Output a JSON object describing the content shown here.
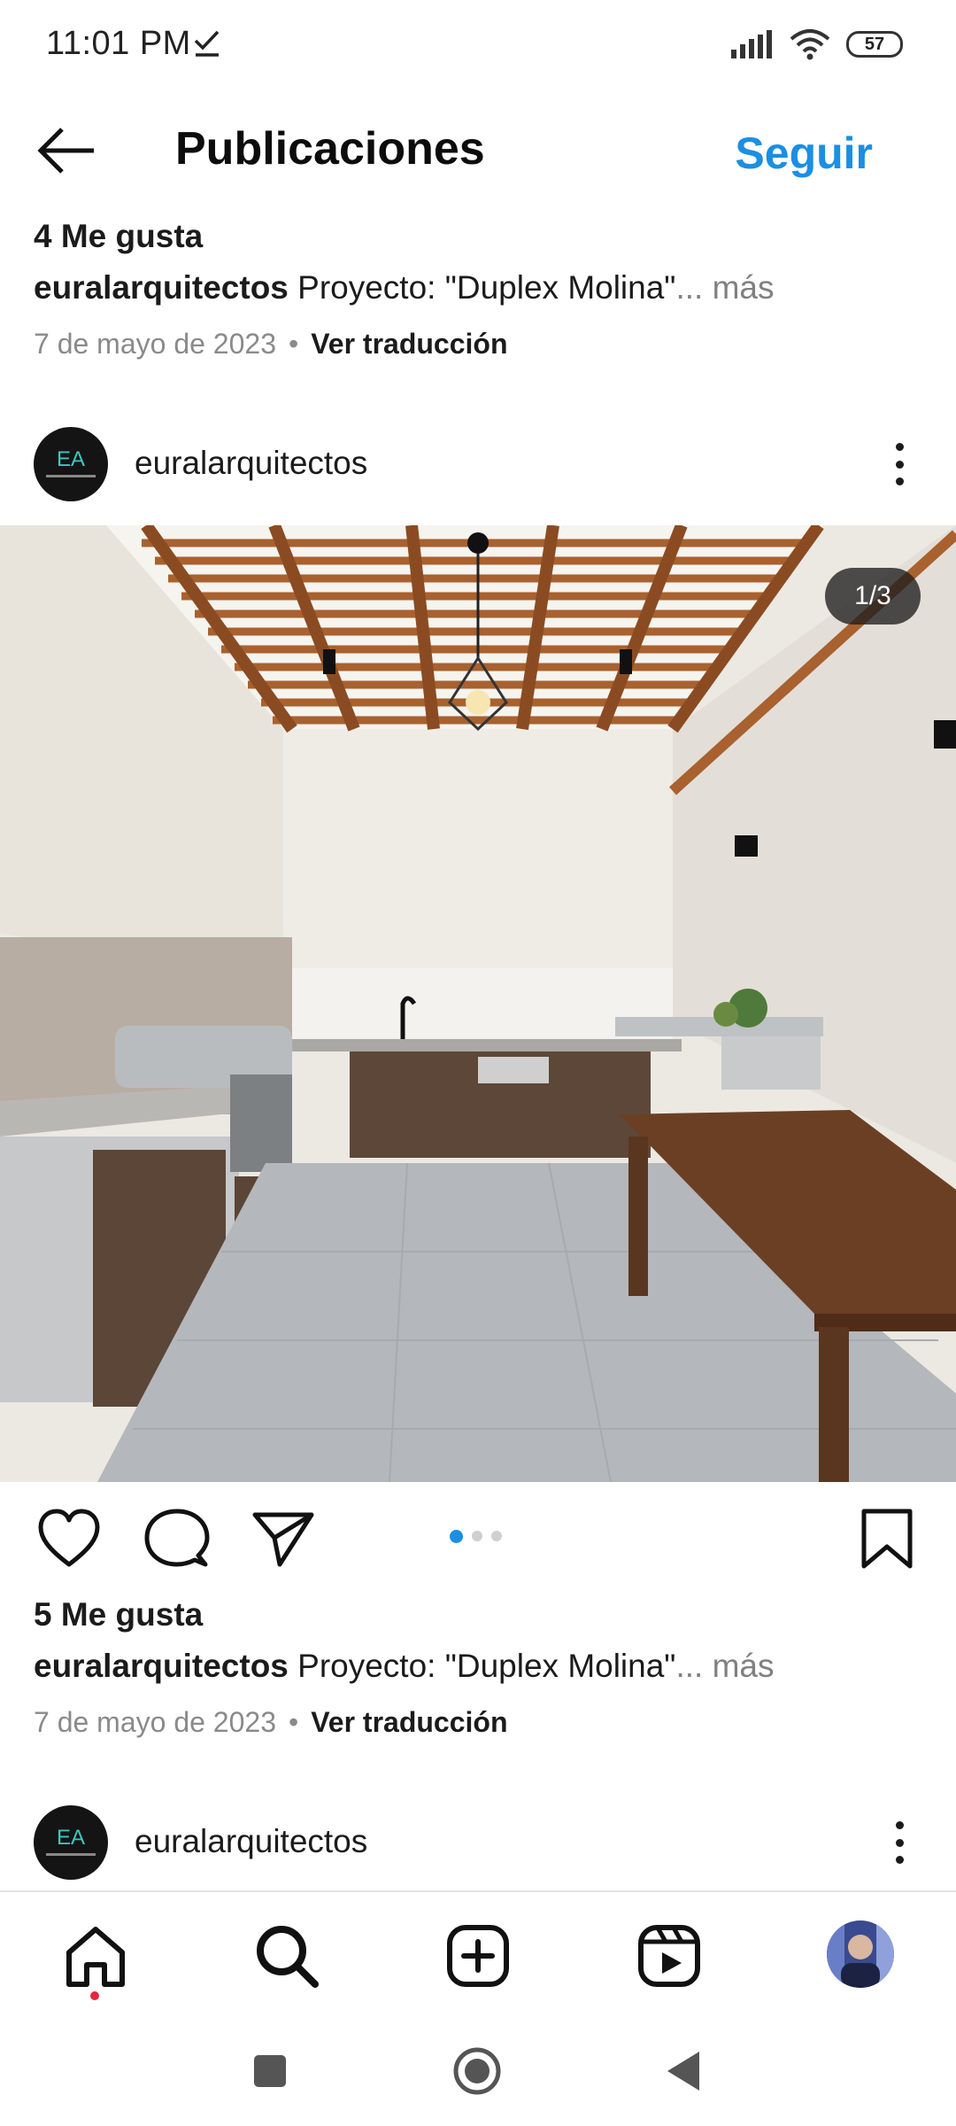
{
  "status_bar": {
    "time": "11:01 PM",
    "battery": "57"
  },
  "header": {
    "title": "Publicaciones",
    "follow_label": "Seguir"
  },
  "posts": [
    {
      "likes": "4 Me gusta",
      "username": "euralarquitectos",
      "caption": " Proyecto: \"Duplex Molina\"",
      "more": "... más",
      "date": "7 de mayo de 2023",
      "separator": "•",
      "translate": "Ver traducción"
    },
    {
      "username": "euralarquitectos",
      "image_counter": "1/3",
      "likes": "5 Me gusta",
      "caption": " Proyecto: \"Duplex Molina\"",
      "more": "... más",
      "date": "7 de mayo de 2023",
      "separator": "•",
      "translate": "Ver traducción"
    },
    {
      "username": "euralarquitectos"
    }
  ],
  "carousel": {
    "total": 3,
    "active_index": 0
  },
  "colors": {
    "accent": "#1a8fe3",
    "notification": "#e8253c"
  },
  "icons": {
    "back": "arrow-left",
    "like": "heart",
    "comment": "speech-bubble",
    "share": "paper-plane",
    "save": "bookmark",
    "home": "home",
    "search": "magnifier",
    "create": "plus-square",
    "reels": "play-square"
  }
}
